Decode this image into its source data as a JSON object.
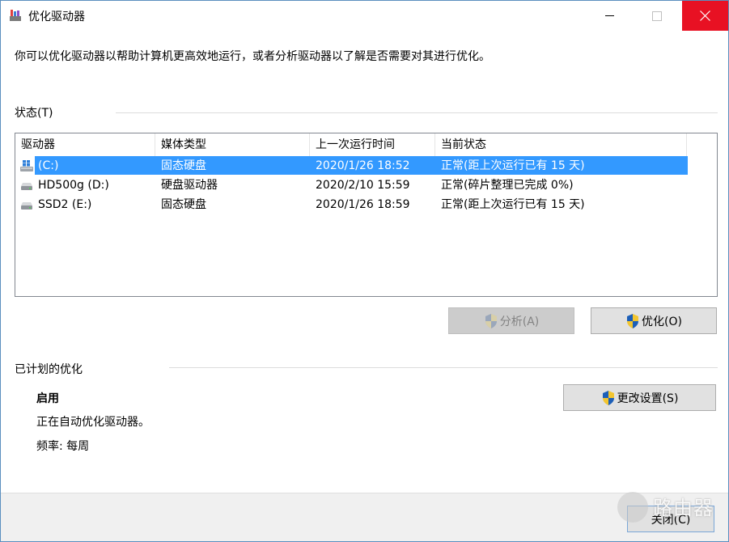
{
  "window": {
    "title": "优化驱动器",
    "intro": "你可以优化驱动器以帮助计算机更高效地运行，或者分析驱动器以了解是否需要对其进行优化。"
  },
  "status": {
    "label": "状态(T)",
    "columns": [
      "驱动器",
      "媒体类型",
      "上一次运行时间",
      "当前状态"
    ],
    "rows": [
      {
        "drive": "(C:)",
        "media": "固态硬盘",
        "last_run": "2020/1/26 18:52",
        "state": "正常(距上次运行已有 15 天)",
        "icon": "windows-drive-icon",
        "selected": true
      },
      {
        "drive": "HD500g (D:)",
        "media": "硬盘驱动器",
        "last_run": "2020/2/10 15:59",
        "state": "正常(碎片整理已完成 0%)",
        "icon": "hard-drive-icon",
        "selected": false
      },
      {
        "drive": "SSD2 (E:)",
        "media": "固态硬盘",
        "last_run": "2020/1/26 18:59",
        "state": "正常(距上次运行已有 15 天)",
        "icon": "hard-drive-icon",
        "selected": false
      }
    ],
    "analyze_label": "分析(A)",
    "optimize_label": "优化(O)"
  },
  "schedule": {
    "label": "已计划的优化",
    "status": "启用",
    "description": "正在自动优化驱动器。",
    "frequency": "频率: 每周",
    "change_label": "更改设置(S)"
  },
  "footer": {
    "close_label": "关闭(C)"
  },
  "watermark": {
    "text": "路由器"
  },
  "colors": {
    "selection": "#3399ff",
    "close_hover": "#e81123",
    "shield_blue": "#1c5fb8",
    "shield_yellow": "#f2c530"
  }
}
